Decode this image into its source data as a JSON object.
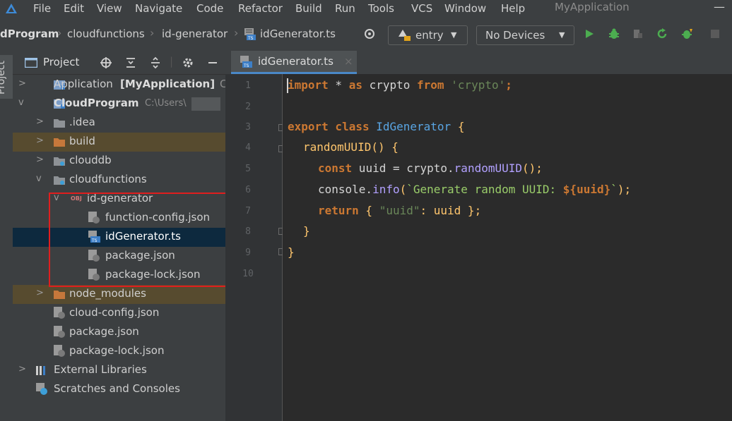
{
  "menubar": {
    "items": [
      {
        "label": "File"
      },
      {
        "label": "Edit"
      },
      {
        "label": "View"
      },
      {
        "label": "Navigate"
      },
      {
        "label": "Code"
      },
      {
        "label": "Refactor"
      },
      {
        "label": "Build"
      },
      {
        "label": "Run"
      },
      {
        "label": "Tools"
      },
      {
        "label": "VCS"
      },
      {
        "label": "Window"
      },
      {
        "label": "Help"
      }
    ],
    "app_title": "MyApplication",
    "minimize": "—"
  },
  "navbar": {
    "breadcrumbs": [
      "dProgram",
      "cloudfunctions",
      "id-generator",
      "idGenerator.ts"
    ],
    "run_config": "entry",
    "device": "No Devices"
  },
  "tool_window": {
    "side_tab": "Project",
    "title": "Project"
  },
  "tree": [
    {
      "label": "Application",
      "bold": "[MyApplication]",
      "suffix": "C"
    },
    {
      "label": "CloudProgram",
      "suffix": "C:\\Users\\"
    },
    {
      "label": ".idea"
    },
    {
      "label": "build"
    },
    {
      "label": "clouddb"
    },
    {
      "label": "cloudfunctions"
    },
    {
      "label": "id-generator"
    },
    {
      "label": "function-config.json"
    },
    {
      "label": "idGenerator.ts"
    },
    {
      "label": "package.json"
    },
    {
      "label": "package-lock.json"
    },
    {
      "label": "node_modules"
    },
    {
      "label": "cloud-config.json"
    },
    {
      "label": "package.json"
    },
    {
      "label": "package-lock.json"
    },
    {
      "label": "External Libraries"
    },
    {
      "label": "Scratches and Consoles"
    }
  ],
  "editor": {
    "tab_label": "idGenerator.ts",
    "line_numbers": [
      "1",
      "2",
      "3",
      "4",
      "5",
      "6",
      "7",
      "8",
      "9",
      "10"
    ],
    "code": {
      "l1": {
        "kw1": "import",
        "mid": " * ",
        "kw2": "as",
        "id": " crypto ",
        "kw3": "from",
        "str": " 'crypto'",
        "end": ";"
      },
      "l3": {
        "kw1": "export",
        "kw2": " class",
        "cls": " IdGenerator",
        "end": " {"
      },
      "l4": {
        "fn": "randomUUID",
        "end": "() {"
      },
      "l5": {
        "kw": "const",
        "var": " uuid = crypto.",
        "meth": "randomUUID",
        "end": "();"
      },
      "l6": {
        "obj": "console.",
        "meth": "info",
        "open": "(",
        "tpl": "`Generate random UUID: ",
        "interp": "${uuid}",
        "tpl2": "`",
        "end": ");"
      },
      "l7": {
        "kw": "return",
        "open": " { ",
        "str": "\"uuid\"",
        "end": ": uuid };"
      },
      "l8": "}",
      "l9": "}"
    }
  },
  "colors": {
    "accent": "#4a88c7",
    "highlight": "#e01e1e",
    "run_green": "#4cad50"
  }
}
